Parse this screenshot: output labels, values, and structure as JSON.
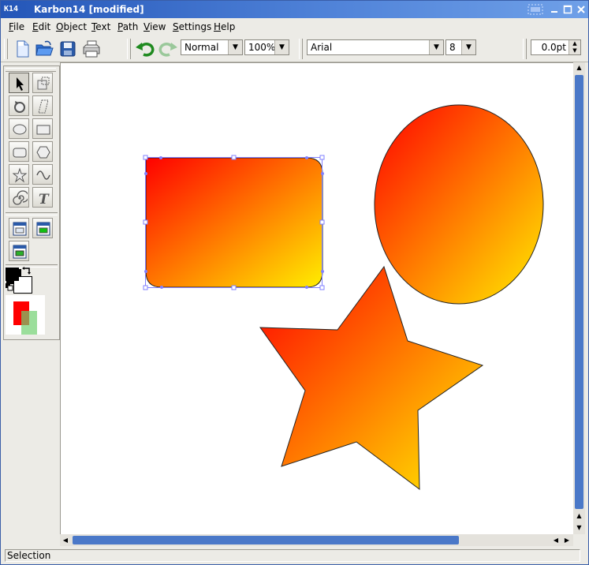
{
  "window": {
    "title": "Karbon14 [modified]",
    "app_icon_text": "K14",
    "buttons": [
      "sticky-icon",
      "minimize-icon",
      "maximize-icon",
      "close-icon"
    ]
  },
  "menu": [
    {
      "label": "File",
      "accel": "F",
      "rest": "ile"
    },
    {
      "label": "Edit",
      "accel": "E",
      "rest": "dit"
    },
    {
      "label": "Object",
      "accel": "O",
      "rest": "bject"
    },
    {
      "label": "Text",
      "accel": "T",
      "rest": "ext"
    },
    {
      "label": "Path",
      "accel": "P",
      "rest": "ath"
    },
    {
      "label": "View",
      "accel": "V",
      "rest": "iew"
    },
    {
      "label": "Settings",
      "accel": "S",
      "rest": "ettings"
    },
    {
      "label": "Help",
      "accel": "H",
      "rest": "elp"
    }
  ],
  "toolbar": {
    "view_mode": "Normal",
    "zoom": "100%",
    "font_family": "Arial",
    "font_size": "8",
    "stroke_width": "0.0pt",
    "icons": [
      "new-document-icon",
      "open-folder-icon",
      "save-icon",
      "print-icon",
      "undo-icon",
      "redo-icon"
    ]
  },
  "toolbox": {
    "tools": [
      "select-icon",
      "select-nodes-icon",
      "rotate-icon",
      "shear-icon",
      "ellipse-icon",
      "rectangle-icon",
      "rounded-rectangle-icon",
      "polygon-icon",
      "star-icon",
      "sinus-icon",
      "spiral-icon",
      "text-icon"
    ],
    "active_tool": "select-icon",
    "extra_tools": [
      "gradient-icon",
      "pattern-icon",
      "image-icon"
    ],
    "stroke_color": "#000000",
    "fill_color": "#ffffff",
    "color_preview": {
      "fill": "#ff0000",
      "stroke": "#90e090"
    },
    "swap_icon": "swap-colors-icon",
    "default_icon": "default-colors-icon"
  },
  "shapes": {
    "gradient_start": "#ff0000",
    "gradient_end": "#ffee00",
    "selection_color": "#8080ff",
    "items": [
      "rounded-rectangle",
      "ellipse",
      "star"
    ]
  },
  "status": {
    "text": "Selection"
  },
  "colors": {
    "titlebar": "#2e62c4",
    "scrollbar_thumb": "#4a78c8",
    "window_bg": "#ecebe6"
  }
}
